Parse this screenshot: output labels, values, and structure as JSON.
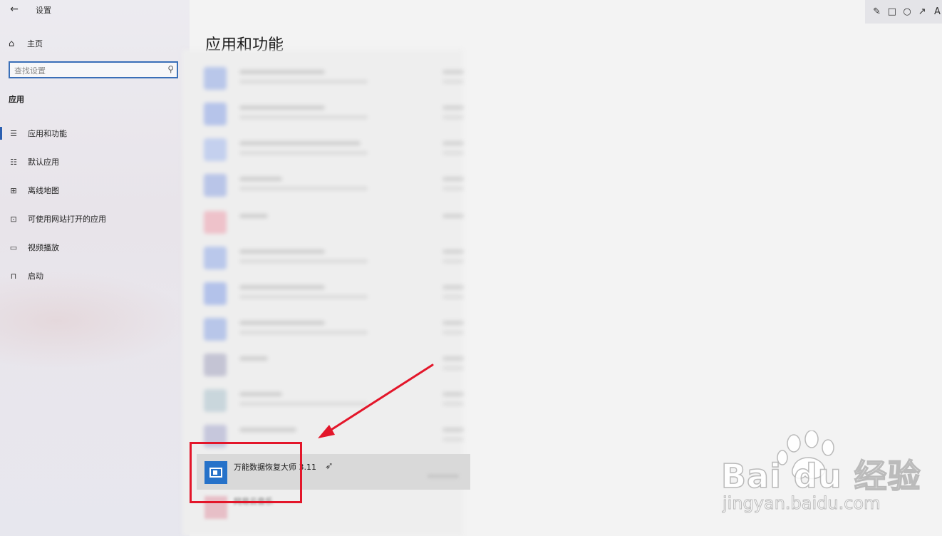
{
  "window": {
    "title": "设置"
  },
  "sidebar": {
    "home_label": "主页",
    "search_placeholder": "查找设置",
    "section_title": "应用",
    "items": [
      {
        "label": "应用和功能",
        "icon": "list-icon",
        "active": true
      },
      {
        "label": "默认应用",
        "icon": "default-apps-icon",
        "active": false
      },
      {
        "label": "离线地图",
        "icon": "map-icon",
        "active": false
      },
      {
        "label": "可使用网站打开的应用",
        "icon": "web-app-icon",
        "active": false
      },
      {
        "label": "视频播放",
        "icon": "video-icon",
        "active": false
      },
      {
        "label": "启动",
        "icon": "startup-icon",
        "active": false
      }
    ]
  },
  "main": {
    "title": "应用和功能",
    "selected_app": {
      "name": "万能数据恢复大师 3.11"
    },
    "next_app": {
      "name": "网易云音乐"
    }
  },
  "annotation": {
    "toolbar_icons": [
      "pencil-icon",
      "rectangle-icon",
      "circle-icon",
      "arrow-icon",
      "text-icon"
    ],
    "color": "#e3162a"
  },
  "watermark": {
    "brand": "Bai du 经验",
    "url": "jingyan.baidu.com"
  },
  "colors": {
    "accent": "#2b5fb0",
    "app_icon_blue": "#2672c9"
  }
}
